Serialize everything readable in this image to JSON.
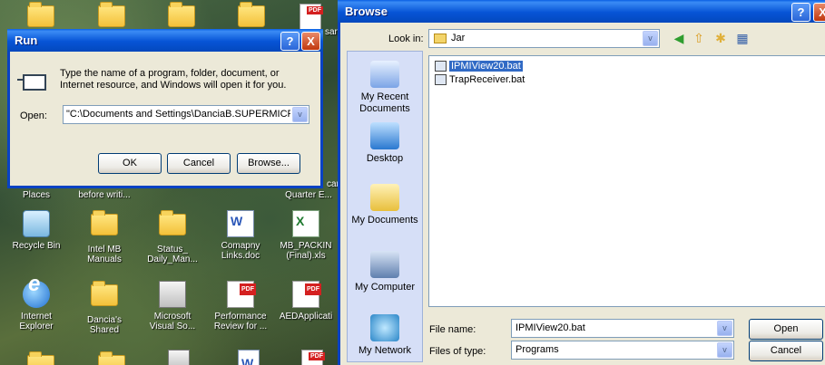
{
  "desktop": {
    "icons": [
      {
        "name": "places",
        "label": "Places"
      },
      {
        "name": "before-writing",
        "label": "before writi..."
      },
      {
        "name": "quarter-e",
        "label": "Quarter E..."
      },
      {
        "name": "recycle-bin",
        "label": "Recycle Bin"
      },
      {
        "name": "intel-mb-manuals",
        "label": "Intel MB Manuals"
      },
      {
        "name": "status-daily",
        "label": "Status_ Daily_Man..."
      },
      {
        "name": "comapny-links",
        "label": "Comapny Links.doc"
      },
      {
        "name": "mb-packing",
        "label": "MB_PACKIN (Final).xls"
      },
      {
        "name": "internet-explorer",
        "label": "Internet Explorer"
      },
      {
        "name": "dancias-shared",
        "label": "Dancia's Shared"
      },
      {
        "name": "microsoft-visual-so",
        "label": "Microsoft Visual So..."
      },
      {
        "name": "performance-review",
        "label": "Performance Review for ..."
      },
      {
        "name": "aedapplicati",
        "label": "AEDApplicati"
      }
    ],
    "partial_labels": {
      "sar": "sar",
      "cane": "cane"
    }
  },
  "run_dialog": {
    "title": "Run",
    "help_label": "?",
    "close_label": "X",
    "description": "Type the name of a program, folder, document, or Internet resource, and Windows will open it for you.",
    "open_label": "Open:",
    "open_value": "\"C:\\Documents and Settings\\DanciaB.SUPERMICRO\\",
    "dropdown_glyph": "v",
    "ok_label": "OK",
    "cancel_label": "Cancel",
    "browse_label": "Browse..."
  },
  "browse_dialog": {
    "title": "Browse",
    "help_label": "?",
    "close_label": "X",
    "look_in_label": "Look in:",
    "look_in_value": "Jar",
    "places": [
      {
        "label": "My Recent Documents"
      },
      {
        "label": "Desktop"
      },
      {
        "label": "My Documents"
      },
      {
        "label": "My Computer"
      },
      {
        "label": "My Network"
      }
    ],
    "files": [
      {
        "name": "IPMIView20.bat",
        "selected": true
      },
      {
        "name": "TrapReceiver.bat",
        "selected": false
      }
    ],
    "file_name_label": "File name:",
    "file_name_value": "IPMIView20.bat",
    "files_of_type_label": "Files of type:",
    "files_of_type_value": "Programs",
    "open_label": "Open",
    "cancel_label": "Cancel",
    "dropdown_glyph": "v"
  },
  "colors": {
    "titlebar_blue": "#0754d6",
    "dialog_face": "#ece9d8",
    "selection": "#316ac5",
    "places_bar": "#d6dff7"
  }
}
